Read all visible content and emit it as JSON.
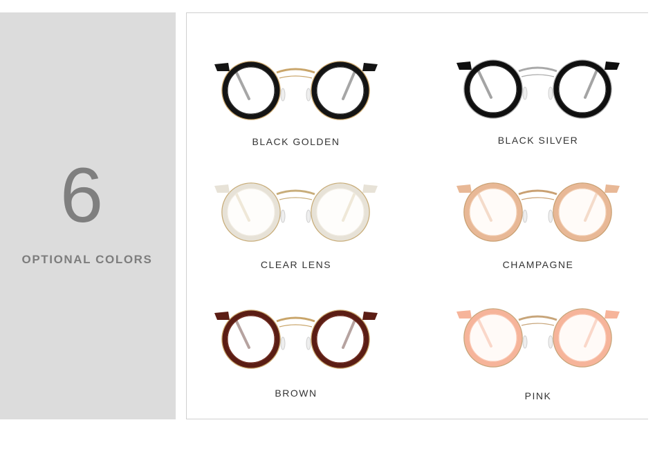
{
  "summary": {
    "count": "6",
    "caption": "OPTIONAL COLORS"
  },
  "colors": [
    {
      "label": "BLACK GOLDEN",
      "rim": "#141414",
      "inner": "#1e1e1e",
      "metal": "#c9a56a",
      "temple": "#222222",
      "tint": "#ffffff"
    },
    {
      "label": "BLACK SILVER",
      "rim": "#0f0f0f",
      "inner": "#1a1a1a",
      "metal": "#a9a9a9",
      "temple": "#1c1c1c",
      "tint": "#ffffff"
    },
    {
      "label": "CLEAR LENS",
      "rim": "#e7e2d7",
      "inner": "#f1ece2",
      "metal": "#c8ad7a",
      "temple": "#d9cba9",
      "tint": "#fdfcf8"
    },
    {
      "label": "CHAMPAGNE",
      "rim": "#e8b896",
      "inner": "#f2cdb1",
      "metal": "#c9a072",
      "temple": "#e3b08c",
      "tint": "#fff8f3"
    },
    {
      "label": "BROWN",
      "rim": "#5b1d14",
      "inner": "#6e2417",
      "metal": "#c9a56a",
      "temple": "#4a1a12",
      "tint": "#ffffff"
    },
    {
      "label": "PINK",
      "rim": "#f6b49a",
      "inner": "#fac7b2",
      "metal": "#c7a57a",
      "temple": "#f2a98d",
      "tint": "#fff6f2"
    }
  ]
}
